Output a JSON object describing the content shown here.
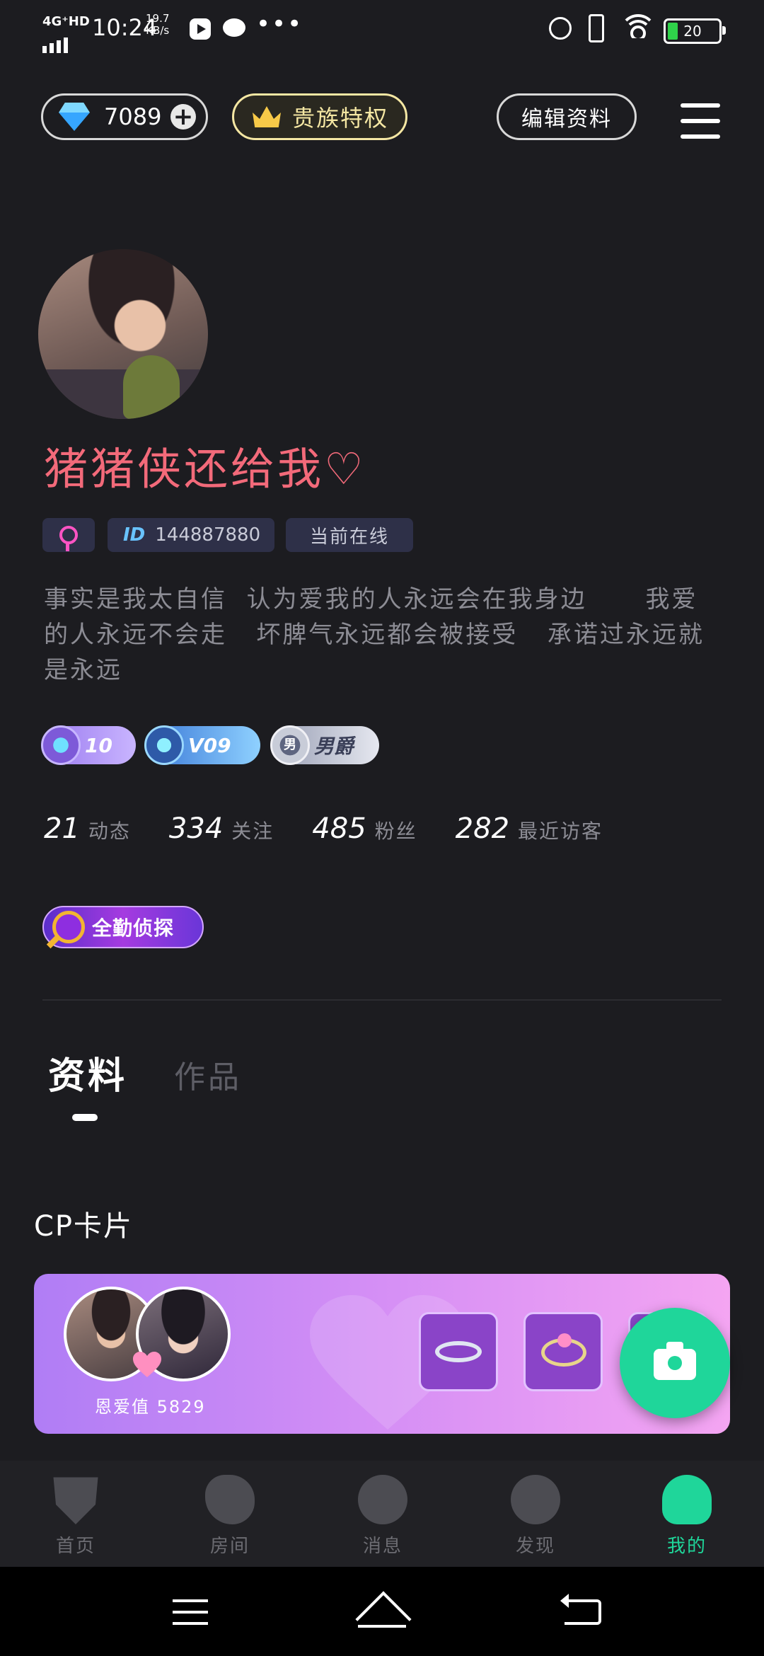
{
  "status_bar": {
    "network": "4G⁺HD",
    "time": "10:24",
    "speed_value": "19.7",
    "speed_unit": "KB/s",
    "more": "•••",
    "battery": "20"
  },
  "top_bar": {
    "diamond_count": "7089",
    "add_symbol": "+",
    "vip_label": "贵族特权",
    "edit_label": "编辑资料"
  },
  "profile": {
    "nickname": "猪猪侠还给我♡",
    "id_prefix": "ID",
    "id_number": "144887880",
    "online_status": "当前在线",
    "bio": "事实是我太自信  认为爱我的人永远会在我身边      我爱的人永远不会走   坏脾气永远都会被接受   承诺过永远就是永远",
    "level_badge": "10",
    "vip_badge": "V09",
    "rank_emblem": "男",
    "rank_badge": "男爵",
    "stats": [
      {
        "value": "21",
        "label": "动态"
      },
      {
        "value": "334",
        "label": "关注"
      },
      {
        "value": "485",
        "label": "粉丝"
      },
      {
        "value": "282",
        "label": "最近访客"
      }
    ],
    "detective_badge": "全勤侦探"
  },
  "tabs": {
    "active": "资料",
    "inactive": "作品"
  },
  "cp_section": {
    "title": "CP卡片",
    "love_value": "恩爱值 5829"
  },
  "bottom_nav": [
    {
      "label": "首页",
      "icon": "mask-icon"
    },
    {
      "label": "房间",
      "icon": "room-icon"
    },
    {
      "label": "消息",
      "icon": "message-icon"
    },
    {
      "label": "发现",
      "icon": "planet-icon"
    },
    {
      "label": "我的",
      "icon": "me-icon",
      "active": true
    }
  ],
  "colors": {
    "background": "#1c1c20",
    "accent_green": "#1fd69a",
    "nickname_pink": "#f36a7a",
    "vip_gold": "#f5e7a3"
  }
}
